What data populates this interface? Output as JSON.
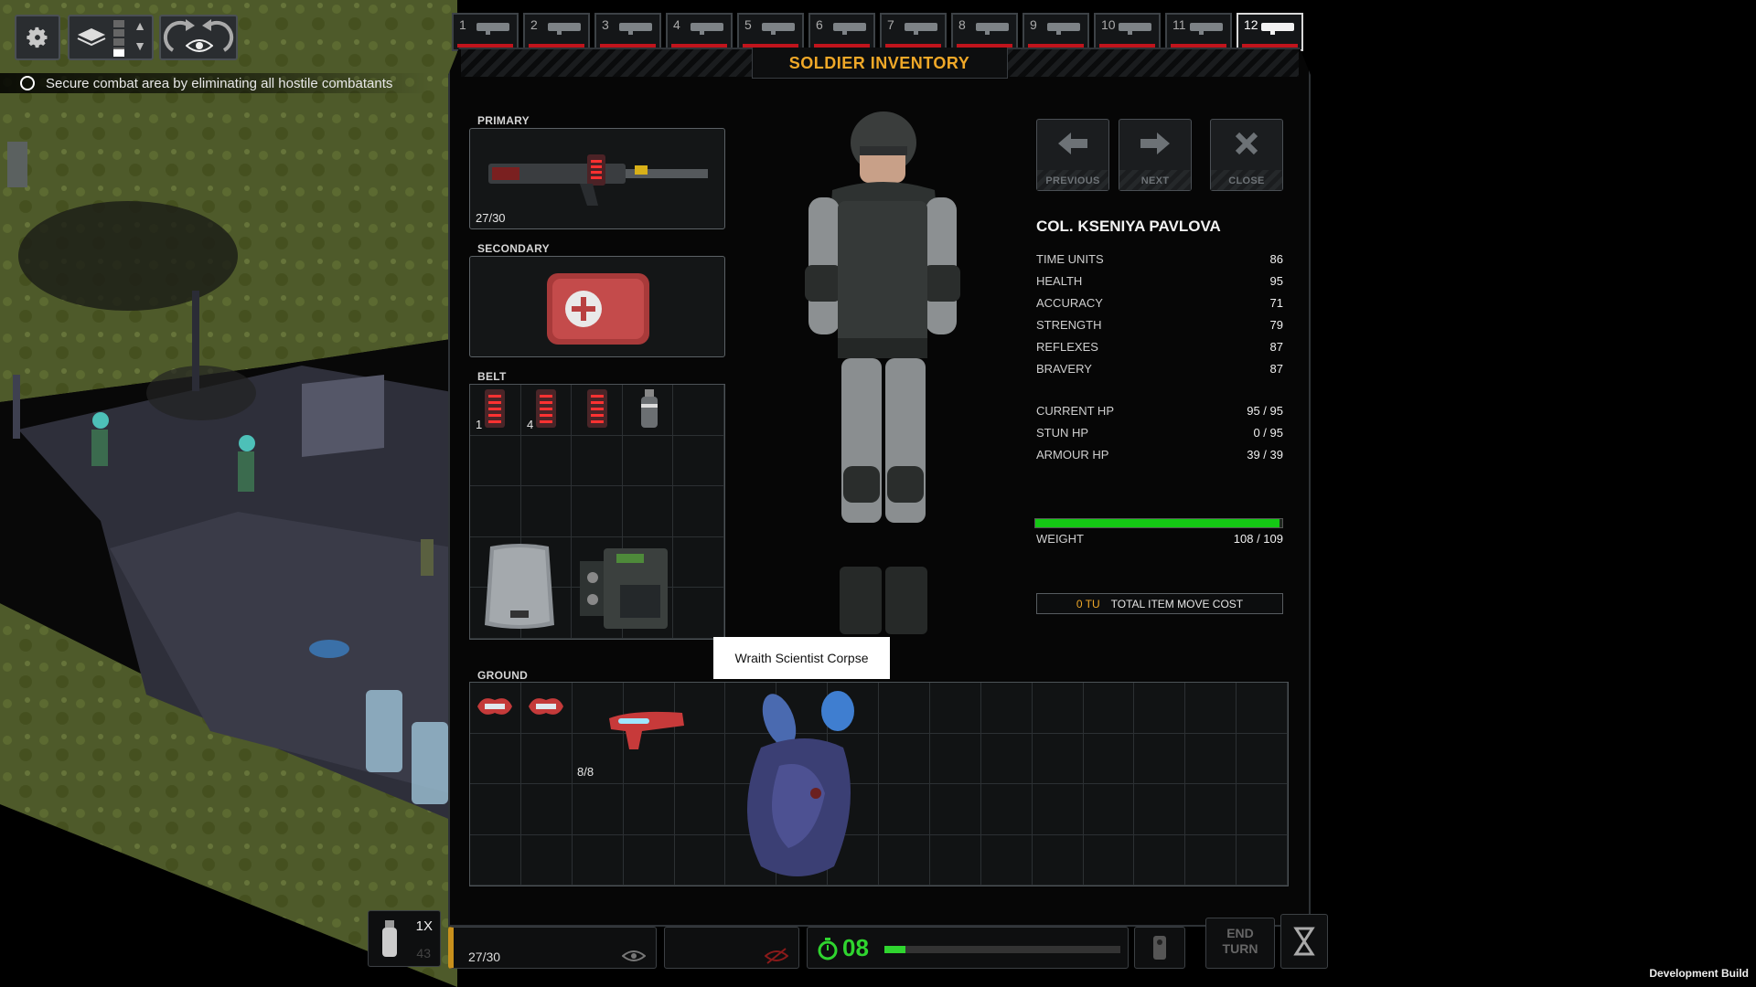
{
  "toolbar": {
    "settings_icon": "gear-icon",
    "layers_icon": "layers-icon",
    "rotate_icon": "rotate-icon",
    "eye_icon": "eye-icon"
  },
  "objective": {
    "text": "Secure combat area by eliminating all hostile combatants"
  },
  "soldier_tabs": [
    {
      "num": "1"
    },
    {
      "num": "2"
    },
    {
      "num": "3"
    },
    {
      "num": "4"
    },
    {
      "num": "5"
    },
    {
      "num": "6"
    },
    {
      "num": "7"
    },
    {
      "num": "8"
    },
    {
      "num": "9"
    },
    {
      "num": "10"
    },
    {
      "num": "11"
    },
    {
      "num": "12"
    }
  ],
  "selected_tab": "12",
  "panel": {
    "title": "SOLDIER INVENTORY",
    "primary_label": "PRIMARY",
    "primary_ammo": "27/30",
    "secondary_label": "SECONDARY",
    "belt_label": "BELT",
    "belt_counts": [
      "1",
      "4"
    ],
    "ground_label": "GROUND",
    "ground_ammo": "8/8",
    "tooltip": "Wraith Scientist Corpse"
  },
  "nav": {
    "previous": "PREVIOUS",
    "next": "NEXT",
    "close": "CLOSE"
  },
  "soldier": {
    "name": "COL. KSENIYA PAVLOVA",
    "stats": [
      {
        "label": "TIME UNITS",
        "value": "86"
      },
      {
        "label": "HEALTH",
        "value": "95"
      },
      {
        "label": "ACCURACY",
        "value": "71"
      },
      {
        "label": "STRENGTH",
        "value": "79"
      },
      {
        "label": "REFLEXES",
        "value": "87"
      },
      {
        "label": "BRAVERY",
        "value": "87"
      }
    ],
    "hp": [
      {
        "label": "CURRENT HP",
        "value": "95 / 95"
      },
      {
        "label": "STUN HP",
        "value": "0 / 95"
      },
      {
        "label": "ARMOUR HP",
        "value": "39 / 39"
      }
    ],
    "weight_label": "WEIGHT",
    "weight_value": "108 / 109",
    "weight_fraction": 0.99,
    "tu_cost": "0 TU",
    "tu_cost_label": "TOTAL ITEM MOVE COST"
  },
  "hud": {
    "grenade_count": "1X",
    "grenade_dim": "43",
    "weapon_ammo": "27/30",
    "turn_number": "08",
    "end_turn": "END\nTURN"
  },
  "colors": {
    "accent": "#f0a828",
    "health_red": "#c0141c",
    "weight_green": "#14c814"
  },
  "dev_build": "Development Build"
}
